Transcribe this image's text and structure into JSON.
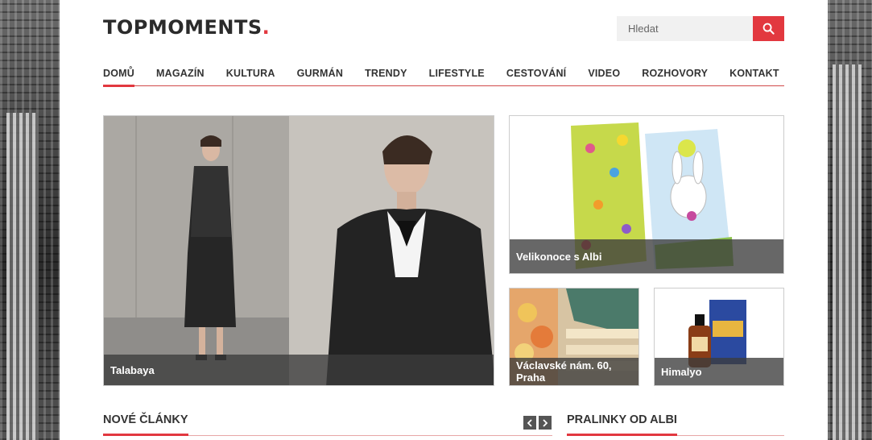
{
  "brand": {
    "name": "TOPMOMENTS",
    "dot": ".",
    "accent_color": "#e2383f"
  },
  "search": {
    "placeholder": "Hledat",
    "icon": "search-icon"
  },
  "nav": {
    "items": [
      {
        "label": "DOMŮ",
        "active": true
      },
      {
        "label": "MAGAZÍN"
      },
      {
        "label": "KULTURA"
      },
      {
        "label": "GURMÁN"
      },
      {
        "label": "TRENDY"
      },
      {
        "label": "LIFESTYLE"
      },
      {
        "label": "CESTOVÁNÍ"
      },
      {
        "label": "VIDEO"
      },
      {
        "label": "ROZHOVORY"
      },
      {
        "label": "KONTAKT"
      }
    ]
  },
  "featured": {
    "main": {
      "caption": "Talabaya"
    },
    "easter": {
      "caption": "Velikonoce s Albi"
    },
    "praha": {
      "caption": "Václavské nám. 60, Praha"
    },
    "himalyo": {
      "caption": "Himalyo"
    }
  },
  "sections": {
    "new_articles": "NOVÉ ČLÁNKY",
    "albi": "PRALINKY OD ALBI"
  },
  "carousel": {
    "prev_icon": "chevron-left-icon",
    "next_icon": "chevron-right-icon"
  }
}
